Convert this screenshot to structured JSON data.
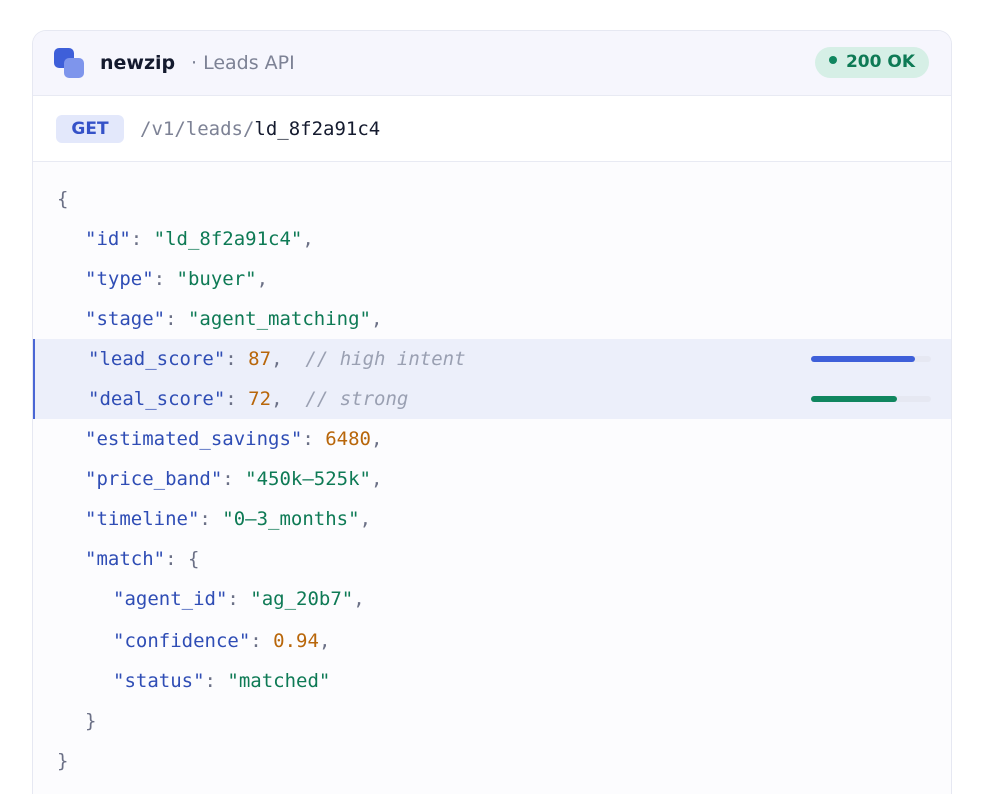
{
  "header": {
    "brand": "newzip",
    "subtitle": "· Leads API",
    "status_label": "200 OK",
    "logo_icon": "stacked-squares-logo"
  },
  "request": {
    "method": "GET",
    "path_base": "/v1/leads/",
    "path_id": "ld_8f2a91c4"
  },
  "response": {
    "open_brace": "{",
    "close_brace": "}",
    "id_key": "\"id\"",
    "id_value": "\"ld_8f2a91c4\"",
    "type_key": "\"type\"",
    "type_value": "\"buyer\"",
    "stage_key": "\"stage\"",
    "stage_value": "\"agent_matching\"",
    "lead_score_key": "\"lead_score\"",
    "lead_score_value": "87",
    "lead_score_comment": "// high intent",
    "deal_score_key": "\"deal_score\"",
    "deal_score_value": "72",
    "deal_score_comment": "// strong",
    "savings_key": "\"estimated_savings\"",
    "savings_value": "6480",
    "price_band_key": "\"price_band\"",
    "price_band_value": "\"450k–525k\"",
    "timeline_key": "\"timeline\"",
    "timeline_value": "\"0–3_months\"",
    "match_key": "\"match\"",
    "match_open": "{",
    "match_close": "}",
    "agent_id_key": "\"agent_id\"",
    "agent_id_value": "\"ag_20b7\"",
    "confidence_key": "\"confidence\"",
    "confidence_value": "0.94",
    "status_key": "\"status\"",
    "status_value": "\"matched\""
  },
  "meters": {
    "lead_score_fraction": 0.87,
    "deal_score_fraction": 0.72,
    "lead_score_color": "#3e5fd9",
    "deal_score_color": "#10865f"
  },
  "colors": {
    "accent": "#3e5fd9",
    "success": "#10865f",
    "number": "#b8660a"
  }
}
